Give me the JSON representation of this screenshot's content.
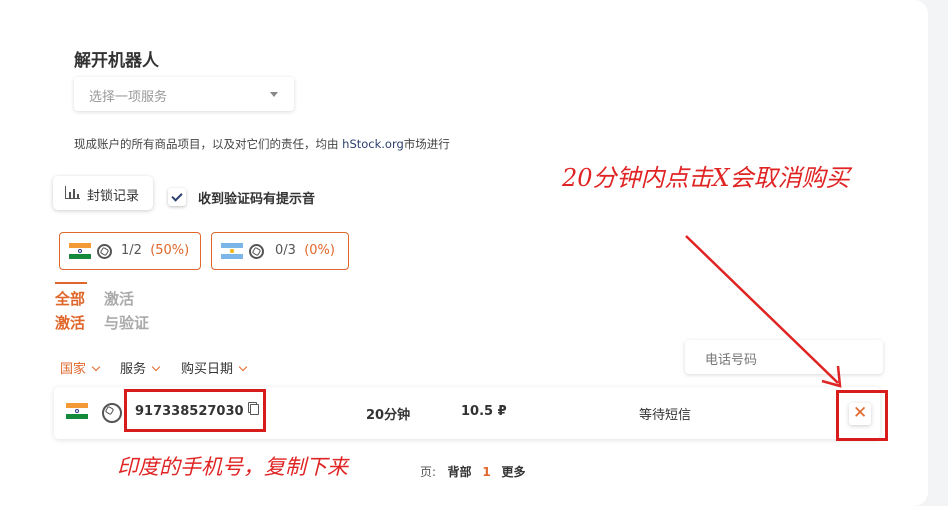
{
  "section": {
    "title": "解开机器人",
    "service_select_placeholder": "选择一项服务",
    "notice_prefix": "现成账户的所有商品项目，以及对它们的责任，均由 ",
    "notice_link": "hStock.org",
    "notice_suffix": "市场进行"
  },
  "toolbar": {
    "log_button_label": "封锁记录",
    "sound_checkbox_label": "收到验证码有提示音",
    "sound_checkbox_checked": true
  },
  "stats": [
    {
      "flag": "india-flag",
      "icon": "openai-icon",
      "count": "1/2",
      "percent": "(50%)"
    },
    {
      "flag": "argentina-flag",
      "icon": "openai-icon",
      "count": "0/3",
      "percent": "(0%)"
    }
  ],
  "tabs": {
    "active": "全部\n激活",
    "inactive": "激活\n与验证"
  },
  "filters": {
    "country": "国家",
    "service": "服务",
    "purchase_date": "购买日期",
    "phone_placeholder": "电话号码"
  },
  "order": {
    "flag": "india-flag",
    "service_icon": "openai-icon",
    "phone": "917338527030",
    "duration": "20分钟",
    "price": "10.5 ₽",
    "status": "等待短信",
    "cancel_label": "✕"
  },
  "pagination": {
    "label": "页:",
    "prev": "背部",
    "current": "1",
    "next": "更多"
  },
  "annotations": {
    "cancel_note": "20分钟内点击X会取消购买",
    "copy_note": "印度的手机号，复制下来"
  },
  "colors": {
    "accent": "#e0672b",
    "annotation": "#e02424"
  }
}
